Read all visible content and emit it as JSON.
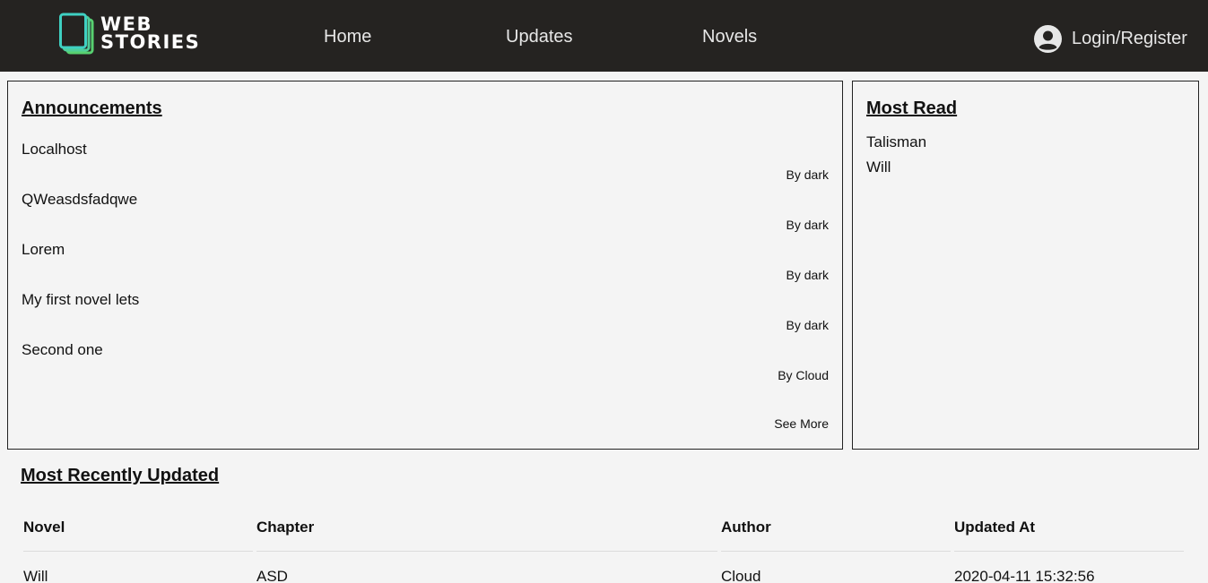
{
  "header": {
    "logo_line1": "WEB",
    "logo_line2": "STORIES",
    "nav": [
      {
        "label": "Home"
      },
      {
        "label": "Updates"
      },
      {
        "label": "Novels"
      }
    ],
    "login_label": "Login/Register"
  },
  "announcements": {
    "title": "Announcements",
    "items": [
      {
        "title": "Localhost",
        "by": "By dark"
      },
      {
        "title": "QWeasdsfadqwe",
        "by": "By dark"
      },
      {
        "title": "Lorem",
        "by": "By dark"
      },
      {
        "title": "My first novel lets",
        "by": "By dark"
      },
      {
        "title": "Second one",
        "by": "By Cloud"
      }
    ],
    "see_more": "See More"
  },
  "most_read": {
    "title": "Most Read",
    "items": [
      "Talisman",
      "Will"
    ]
  },
  "recent": {
    "title": "Most Recently Updated",
    "columns": [
      "Novel",
      "Chapter",
      "Author",
      "Updated At"
    ],
    "rows": [
      [
        "Will",
        "ASD",
        "Cloud",
        "2020-04-11 15:32:56"
      ]
    ]
  },
  "colors": {
    "header_bg": "#252321",
    "page_bg": "#f4f4f4",
    "logo_teal": "#3fd0c2",
    "logo_green": "#58d070"
  }
}
